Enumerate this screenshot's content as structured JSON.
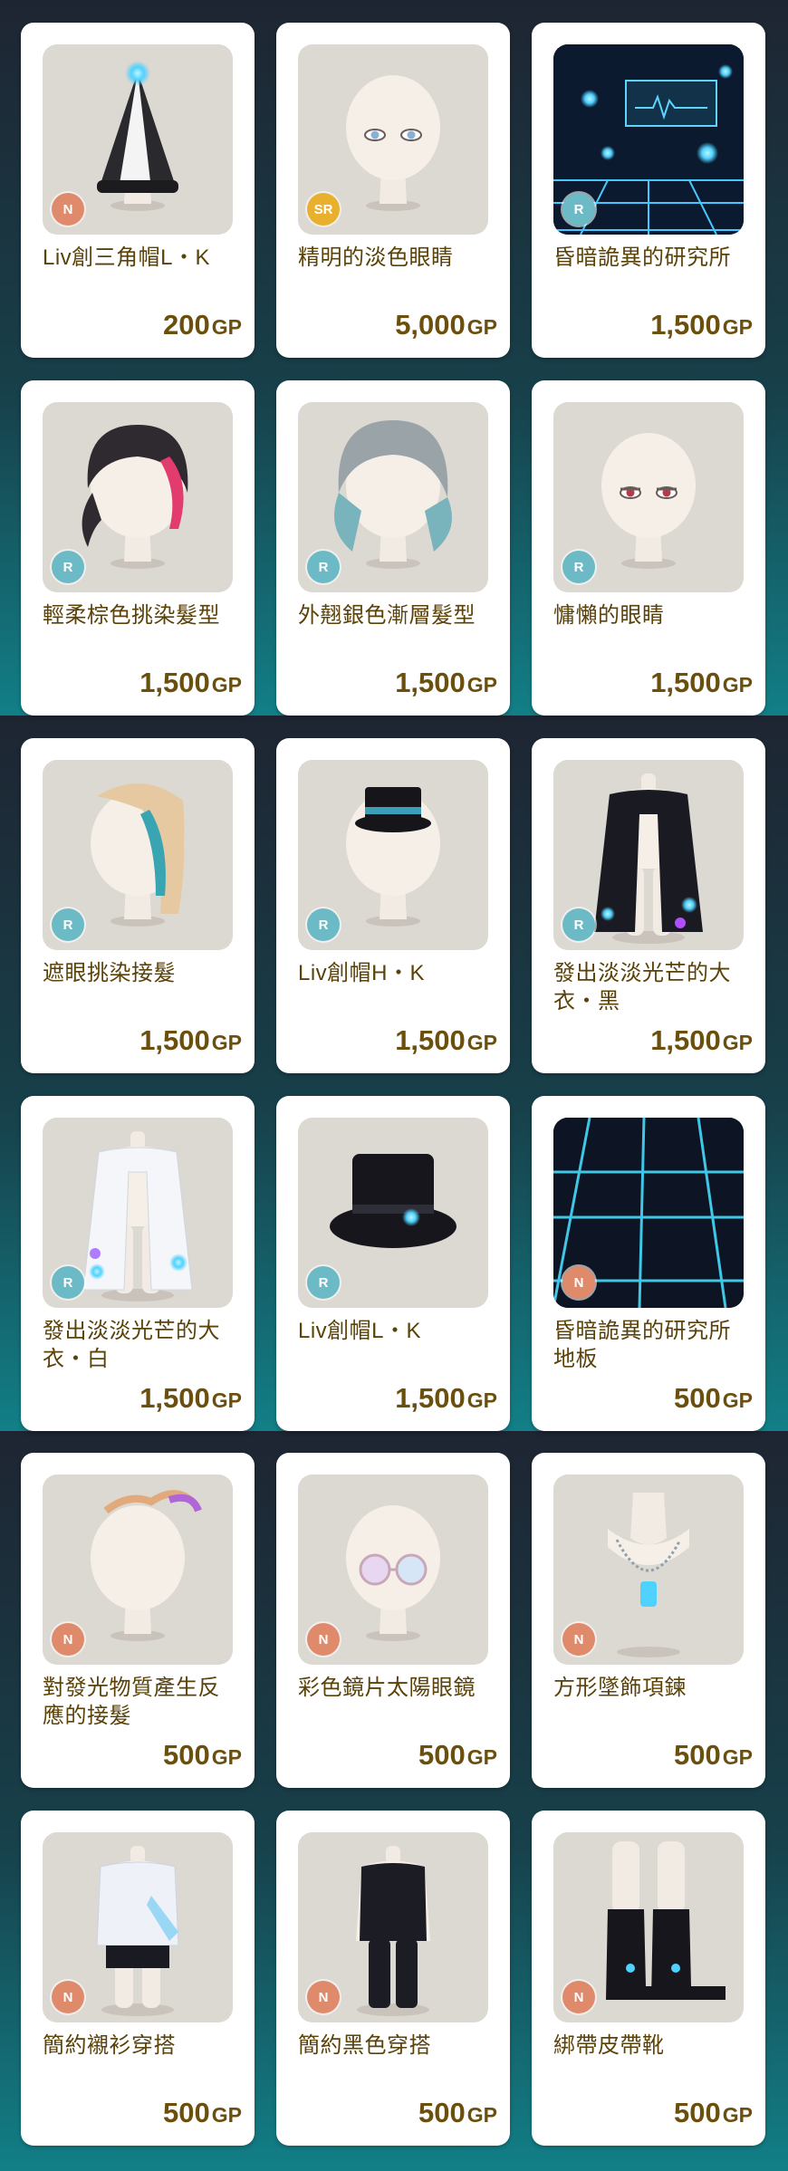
{
  "currency_unit": "GP",
  "items": [
    {
      "name": "Liv創三角帽L・K",
      "price": "200",
      "rarity": "N",
      "icon": "triangle-hat-icon"
    },
    {
      "name": "精明的淡色眼睛",
      "price": "5,000",
      "rarity": "SR",
      "icon": "pale-eyes-icon"
    },
    {
      "name": "昏暗詭異的研究所",
      "price": "1,500",
      "rarity": "R",
      "icon": "lab-background-icon"
    },
    {
      "name": "輕柔棕色挑染髮型",
      "price": "1,500",
      "rarity": "R",
      "icon": "brown-highlight-hair-icon"
    },
    {
      "name": "外翹銀色漸層髮型",
      "price": "1,500",
      "rarity": "R",
      "icon": "silver-gradient-hair-icon"
    },
    {
      "name": "慵懶的眼睛",
      "price": "1,500",
      "rarity": "R",
      "icon": "lazy-eyes-icon"
    },
    {
      "name": "遮眼挑染接髮",
      "price": "1,500",
      "rarity": "R",
      "icon": "eye-cover-hair-extension-icon"
    },
    {
      "name": "Liv創帽H・K",
      "price": "1,500",
      "rarity": "R",
      "icon": "small-top-hat-icon"
    },
    {
      "name": "發出淡淡光芒的大衣・黑",
      "price": "1,500",
      "rarity": "R",
      "icon": "black-glowing-coat-icon"
    },
    {
      "name": "發出淡淡光芒的大衣・白",
      "price": "1,500",
      "rarity": "R",
      "icon": "white-glowing-coat-icon"
    },
    {
      "name": "Liv創帽L・K",
      "price": "1,500",
      "rarity": "R",
      "icon": "large-top-hat-icon"
    },
    {
      "name": "昏暗詭異的研究所地板",
      "price": "500",
      "rarity": "N",
      "icon": "lab-floor-icon"
    },
    {
      "name": "對發光物質產生反應的接髮",
      "price": "500",
      "rarity": "N",
      "icon": "reactive-hair-extension-icon"
    },
    {
      "name": "彩色鏡片太陽眼鏡",
      "price": "500",
      "rarity": "N",
      "icon": "sunglasses-icon"
    },
    {
      "name": "方形墜飾項鍊",
      "price": "500",
      "rarity": "N",
      "icon": "pendant-necklace-icon"
    },
    {
      "name": "簡約襯衫穿搭",
      "price": "500",
      "rarity": "N",
      "icon": "shirt-outfit-icon"
    },
    {
      "name": "簡約黑色穿搭",
      "price": "500",
      "rarity": "N",
      "icon": "black-outfit-icon"
    },
    {
      "name": "綁帶皮帶靴",
      "price": "500",
      "rarity": "N",
      "icon": "laced-boots-icon"
    }
  ]
}
